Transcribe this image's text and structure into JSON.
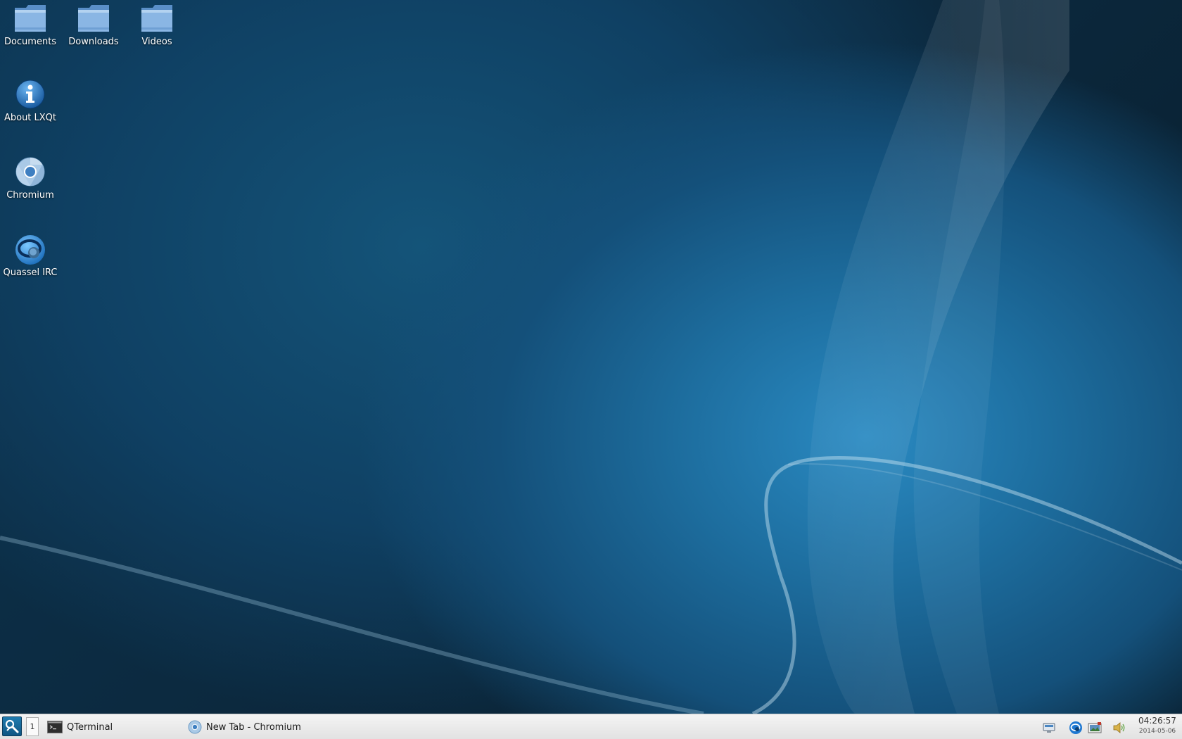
{
  "desktop": {
    "icons": [
      {
        "label": "Documents"
      },
      {
        "label": "Downloads"
      },
      {
        "label": "Videos"
      },
      {
        "label": "About LXQt"
      },
      {
        "label": "Chromium"
      },
      {
        "label": "Quassel IRC"
      }
    ]
  },
  "taskbar": {
    "desktop_number": "1",
    "tasks": [
      {
        "label": "QTerminal",
        "icon": "terminal-icon"
      },
      {
        "label": "New Tab - Chromium",
        "icon": "chromium-icon"
      }
    ],
    "tray": [
      "network-icon",
      "quassel-tray-icon",
      "screenshot-icon",
      "volume-icon"
    ],
    "clock": {
      "time": "04:26:57",
      "date": "2014-05-06"
    }
  },
  "colors": {
    "desktop_accent": "#1d6d9e",
    "taskbar_bg": "#ececec",
    "start_button": "#1a6fa3"
  }
}
